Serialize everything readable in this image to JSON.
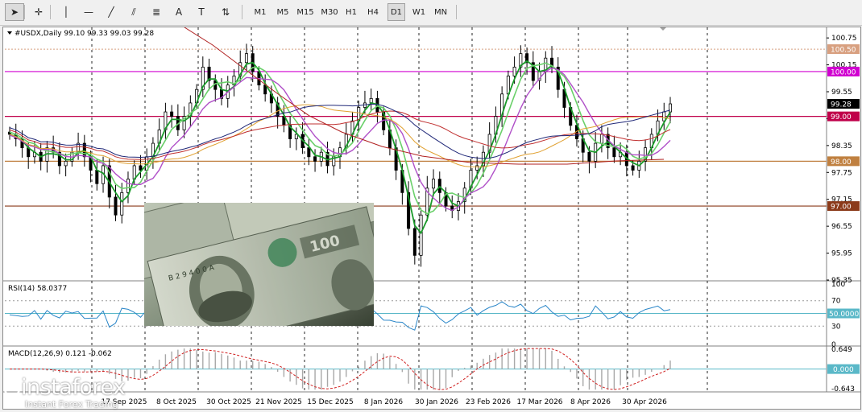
{
  "toolbar": {
    "timeframes": [
      "M1",
      "M5",
      "M15",
      "M30",
      "H1",
      "H4",
      "D1",
      "W1",
      "MN"
    ],
    "active_timeframe": "D1",
    "tools": [
      {
        "name": "cursor-icon",
        "glyph": "➤"
      },
      {
        "name": "crosshair-icon",
        "glyph": "✛"
      },
      {
        "name": "vertical-line-icon",
        "glyph": "│"
      },
      {
        "name": "horizontal-line-icon",
        "glyph": "—"
      },
      {
        "name": "trendline-icon",
        "glyph": "╱"
      },
      {
        "name": "equidistant-channel-icon",
        "glyph": "⫽"
      },
      {
        "name": "fibonacci-icon",
        "glyph": "≣"
      },
      {
        "name": "text-icon",
        "glyph": "A"
      },
      {
        "name": "text-label-icon",
        "glyph": "T"
      },
      {
        "name": "arrows-icon",
        "glyph": "⇅"
      }
    ]
  },
  "chart": {
    "symbol_line": "#USDX,Daily  99.10 99.33 99.03 99.28",
    "price_labels": [
      "100.75",
      "100.15",
      "99.55",
      "98.95",
      "98.35",
      "97.75",
      "97.15",
      "96.55",
      "95.95",
      "95.35"
    ],
    "hlines": [
      {
        "label": "100.50",
        "color": "#d8a080",
        "style": "dotted"
      },
      {
        "label": "100.00",
        "color": "#d000d0",
        "style": "solid"
      },
      {
        "label": "99.00",
        "color": "#c0004a",
        "style": "solid"
      },
      {
        "label": "98.00",
        "color": "#c08040",
        "style": "solid"
      },
      {
        "label": "97.00",
        "color": "#8b3a1a",
        "style": "solid"
      }
    ],
    "current_price_label": "99.28",
    "date_labels": [
      "17 Sep 2025",
      "8 Oct 2025",
      "30 Oct 2025",
      "21 Nov 2025",
      "15 Dec 2025",
      "8 Jan 2026",
      "30 Jan 2026",
      "23 Feb 2026",
      "17 Mar 2026",
      "8 Apr 2026",
      "30 Apr 2026"
    ],
    "rsi": {
      "title": "RSI(14) 58.0377",
      "scale_labels": [
        "100",
        "70",
        "50.0000",
        "30",
        "0"
      ],
      "level_label": "50.0000"
    },
    "macd": {
      "title": "MACD(12,26,9) 0.121 -0.062",
      "scale_labels": [
        "0.649",
        "0.000",
        "-0.643"
      ],
      "zero_label": "0.000"
    }
  },
  "chart_data": {
    "type": "candlestick",
    "title": "#USDX,Daily",
    "ohlc_last": {
      "open": 99.1,
      "high": 99.33,
      "low": 99.03,
      "close": 99.28
    },
    "ylim": [
      95.35,
      100.95
    ],
    "x_ticks": [
      "17 Sep 2025",
      "8 Oct 2025",
      "30 Oct 2025",
      "21 Nov 2025",
      "15 Dec 2025",
      "8 Jan 2026",
      "30 Jan 2026",
      "23 Feb 2026",
      "17 Mar 2026",
      "8 Apr 2026",
      "30 Apr 2026"
    ],
    "closes": [
      98.6,
      98.5,
      98.3,
      98.1,
      98.2,
      98.0,
      98.3,
      98.2,
      97.9,
      98.0,
      98.2,
      98.4,
      98.1,
      97.8,
      97.5,
      97.9,
      97.2,
      96.8,
      97.3,
      97.6,
      97.9,
      97.8,
      98.1,
      98.4,
      98.7,
      99.1,
      99.0,
      98.7,
      99.0,
      99.3,
      99.6,
      100.1,
      99.8,
      99.6,
      99.4,
      99.7,
      99.9,
      100.2,
      100.4,
      100.0,
      99.7,
      99.5,
      99.3,
      99.0,
      98.8,
      98.5,
      98.6,
      98.3,
      98.1,
      98.0,
      98.2,
      97.9,
      98.1,
      98.3,
      98.6,
      98.9,
      99.2,
      99.3,
      99.4,
      99.1,
      98.7,
      98.3,
      97.8,
      97.3,
      96.5,
      95.9,
      96.8,
      97.4,
      97.6,
      97.3,
      97.0,
      96.9,
      97.1,
      97.4,
      97.8,
      97.9,
      98.2,
      98.6,
      99.0,
      99.5,
      99.9,
      100.1,
      100.4,
      100.2,
      99.8,
      100.0,
      100.3,
      100.1,
      99.6,
      99.2,
      98.8,
      98.5,
      98.2,
      98.0,
      98.4,
      98.6,
      98.3,
      98.1,
      98.2,
      97.9,
      97.8,
      98.0,
      98.3,
      98.6,
      98.9,
      99.1,
      99.28
    ],
    "moving_averages": [
      {
        "name": "MA green",
        "color": "#1a9a2a"
      },
      {
        "name": "MA lightgreen",
        "color": "#6ad06a"
      },
      {
        "name": "MA violet",
        "color": "#b050c8"
      },
      {
        "name": "MA orange",
        "color": "#e0a030"
      },
      {
        "name": "MA red",
        "color": "#c03030"
      },
      {
        "name": "MA navy",
        "color": "#202878"
      }
    ],
    "horizontal_levels": [
      100.5,
      100.0,
      99.0,
      98.0,
      97.0
    ],
    "rsi_value": 58.0377,
    "rsi_levels": [
      70,
      50,
      30
    ],
    "macd": {
      "main": 0.121,
      "signal": -0.062,
      "range": [
        -0.643,
        0.649
      ]
    }
  },
  "branding": {
    "logo_text": "instaforex",
    "logo_sub": "Instant Forex Trading"
  }
}
